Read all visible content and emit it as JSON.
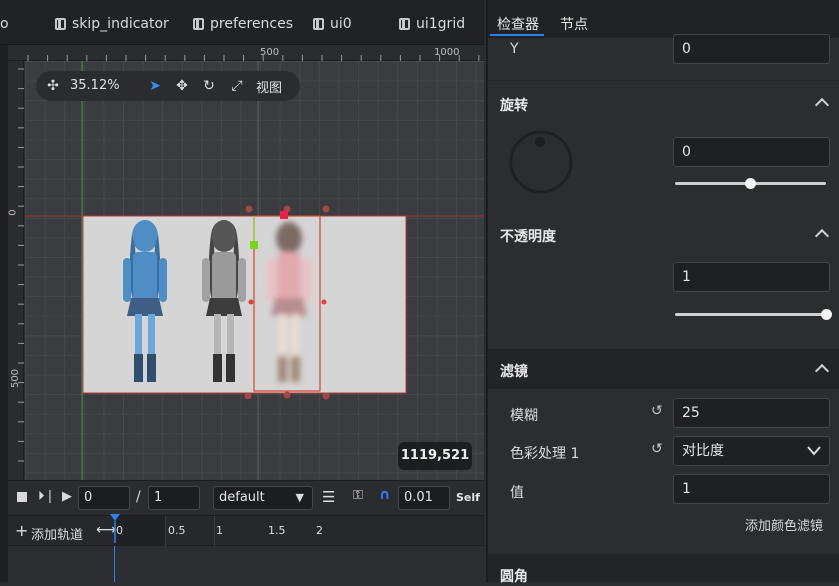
{
  "tabs": [
    {
      "label": "o"
    },
    {
      "label": "skip_indicator"
    },
    {
      "label": "preferences"
    },
    {
      "label": "ui0"
    },
    {
      "label": "ui1grid"
    }
  ],
  "ruler": {
    "top_labels": [
      "500",
      "1000"
    ],
    "left_labels": [
      "0",
      "500"
    ]
  },
  "toolbar": {
    "zoom": "35.12%",
    "view_label": "视图"
  },
  "coord_readout": "1119,521",
  "timeline": {
    "frame": "0",
    "total": "1",
    "separator": "/",
    "animation": "default",
    "speed": "0.01",
    "self_label": "Self",
    "add_track": "添加轨道",
    "ticks": [
      "0",
      "0.5",
      "1",
      "1.5",
      "2"
    ]
  },
  "inspector": {
    "tabs": [
      "检查器",
      "节点"
    ],
    "y_label": "Y",
    "y_value": "0",
    "rotation_title": "旋转",
    "rotation_value": "0",
    "opacity_title": "不透明度",
    "opacity_value": "1",
    "filter_title": "滤镜",
    "blur_label": "模糊",
    "blur_value": "25",
    "color_label": "色彩处理 1",
    "color_value": "对比度",
    "value_label": "值",
    "value_value": "1",
    "add_color_filter": "添加颜色滤镜",
    "corner_title": "圆角",
    "rotation_slider": 0.5,
    "opacity_slider": 1.0
  },
  "colors": {
    "accent": "#2f80ed",
    "selection": "#e0473d",
    "handle_green": "#7cd31c"
  }
}
